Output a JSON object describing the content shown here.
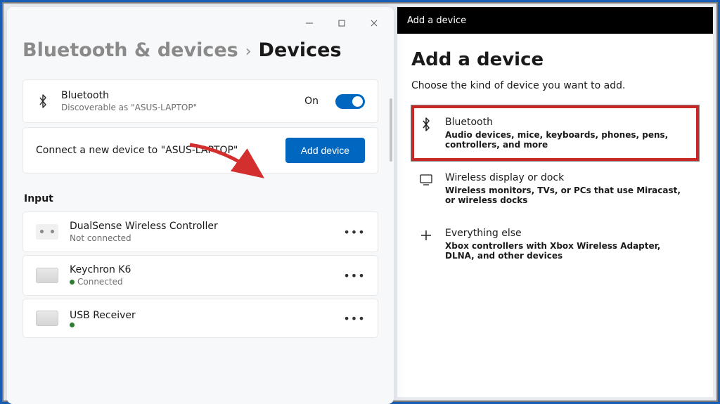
{
  "settings": {
    "breadcrumb_parent": "Bluetooth & devices",
    "breadcrumb_sep": "›",
    "breadcrumb_current": "Devices",
    "bluetooth": {
      "title": "Bluetooth",
      "subtitle": "Discoverable as \"ASUS-LAPTOP\"",
      "state_label": "On"
    },
    "connect": {
      "text": "Connect a new device to \"ASUS-LAPTOP\"",
      "button": "Add device"
    },
    "input_header": "Input",
    "devices": [
      {
        "name": "DualSense Wireless Controller",
        "status": "Not connected",
        "connected": false,
        "icon": "controller"
      },
      {
        "name": "Keychron K6",
        "status": "Connected",
        "connected": true,
        "icon": "keyboard"
      },
      {
        "name": "USB Receiver",
        "status": "",
        "connected": true,
        "icon": "keyboard"
      }
    ]
  },
  "dialog": {
    "window_title": "Add a device",
    "heading": "Add a device",
    "subheading": "Choose the kind of device you want to add.",
    "options": [
      {
        "title": "Bluetooth",
        "desc": "Audio devices, mice, keyboards, phones, pens, controllers, and more",
        "icon": "bluetooth"
      },
      {
        "title": "Wireless display or dock",
        "desc": "Wireless monitors, TVs, or PCs that use Miracast, or wireless docks",
        "icon": "display"
      },
      {
        "title": "Everything else",
        "desc": "Xbox controllers with Xbox Wireless Adapter, DLNA, and other devices",
        "icon": "plus"
      }
    ]
  }
}
